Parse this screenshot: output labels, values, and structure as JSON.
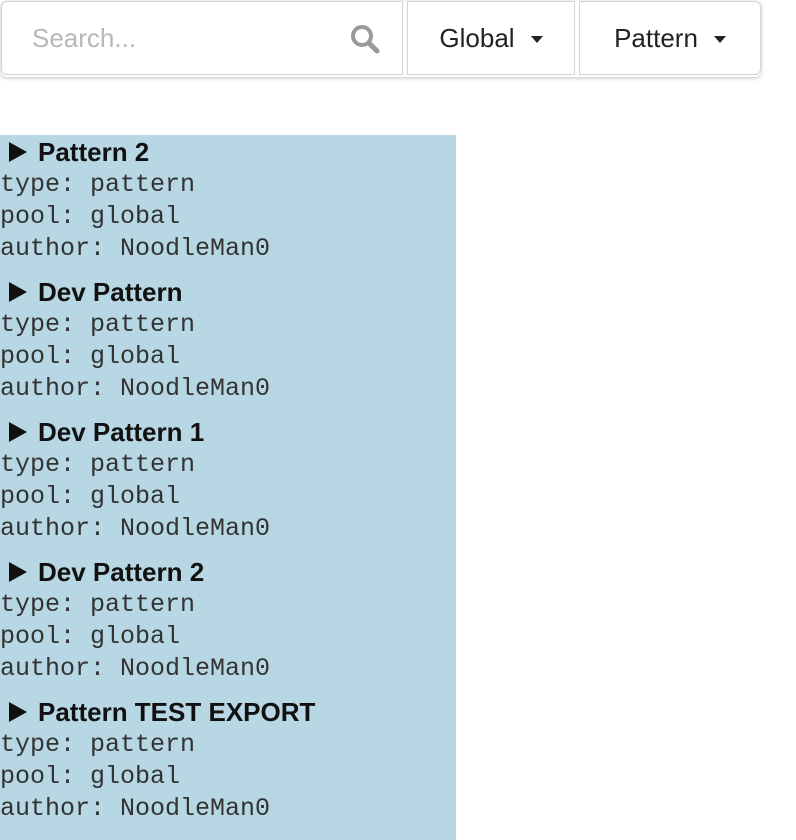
{
  "search": {
    "placeholder": "Search..."
  },
  "filters": {
    "pool_label": "Global",
    "type_label": "Pattern"
  },
  "items": [
    {
      "title": "Pattern 2",
      "type": "type: pattern",
      "pool": "pool: global",
      "author": "author: NoodleMan0"
    },
    {
      "title": "Dev Pattern",
      "type": "type: pattern",
      "pool": "pool: global",
      "author": "author: NoodleMan0"
    },
    {
      "title": "Dev Pattern 1",
      "type": "type: pattern",
      "pool": "pool: global",
      "author": "author: NoodleMan0"
    },
    {
      "title": "Dev Pattern 2",
      "type": "type: pattern",
      "pool": "pool: global",
      "author": "author: NoodleMan0"
    },
    {
      "title": "Pattern TEST EXPORT",
      "type": "type: pattern",
      "pool": "pool: global",
      "author": "author: NoodleMan0"
    }
  ],
  "colors": {
    "list_background": "#b6d7e3",
    "text": "#111111"
  }
}
